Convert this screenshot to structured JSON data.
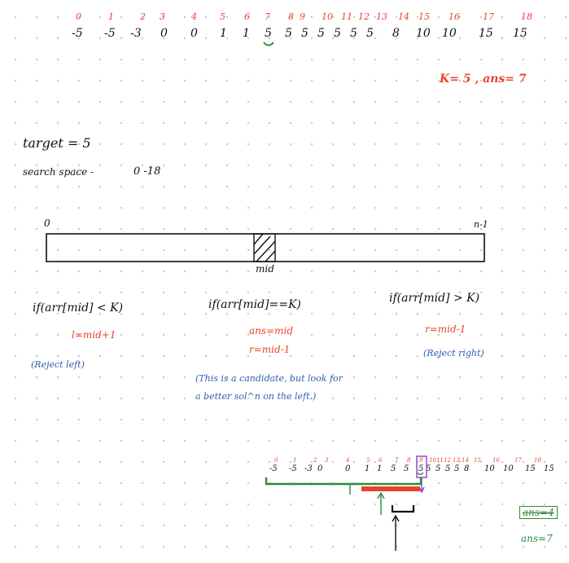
{
  "array": {
    "indices": [
      "0",
      "1",
      "2",
      "3",
      "4",
      "5",
      "6",
      "7",
      "8",
      "9",
      "10",
      "11",
      "12",
      "13",
      "14",
      "15",
      "16",
      "17",
      "18"
    ],
    "values": [
      "-5",
      "-5",
      "-3",
      "0",
      "0",
      "1",
      "1",
      "5",
      "5",
      "5",
      "5",
      "5",
      "5",
      "5",
      "8",
      "10",
      "10",
      "15",
      "15"
    ]
  },
  "summary_note": "K= 5 , ans= 7",
  "target_line": "target = 5",
  "search_space": {
    "label": "search space -",
    "range": "0 -18"
  },
  "bar": {
    "left_label": "0",
    "right_label": "n-1",
    "mid_label": "mid"
  },
  "cases": [
    {
      "condition": "if(arr[mid] < K)",
      "actions": [
        "l=mid+1"
      ],
      "note": "(Reject left)"
    },
    {
      "condition": "if(arr[mid]==K)",
      "actions": [
        "ans=mid",
        "r=mid-1"
      ],
      "note": "(This is a candidate, but look for a better sol^n on the left.)"
    },
    {
      "condition": "if(arr[mid] > K)",
      "actions": [
        "r=mid-1"
      ],
      "note": "(Reject right)"
    }
  ],
  "ans_box": {
    "old": "ans=4",
    "new": "ans=7"
  },
  "colors": {
    "red": "#e8432c",
    "black": "#111111",
    "blue": "#2f5fb0",
    "green": "#2e8b3a",
    "purple": "#8a3fc6",
    "grid_dot": "#c9c9c9"
  }
}
